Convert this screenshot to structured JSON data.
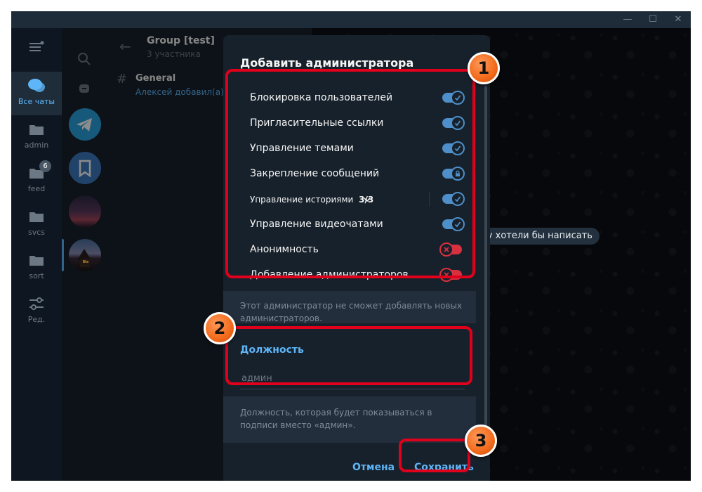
{
  "topic_panel": {
    "back_arrow": "←",
    "group_title": "Group [test]",
    "group_subtitle": "3 участника",
    "topic_hash": "#",
    "topic_name": "General",
    "topic_preview": "Алексей добавил(а) С"
  },
  "folders": [
    {
      "label": "Все чаты",
      "icon": "chats-icon"
    },
    {
      "label": "admin",
      "icon": "folder-icon"
    },
    {
      "label": "feed",
      "icon": "folder-icon",
      "badge": "6"
    },
    {
      "label": "svcs",
      "icon": "folder-icon"
    },
    {
      "label": "sort",
      "icon": "folder-icon"
    },
    {
      "label": "Ред.",
      "icon": "edit-folders-icon"
    }
  ],
  "chat_pill": "му хотели бы написать",
  "dialog": {
    "title": "Добавить администратора",
    "permissions": [
      {
        "label": "Блокировка пользователей",
        "state": "on"
      },
      {
        "label": "Пригласительные ссылки",
        "state": "on"
      },
      {
        "label": "Управление темами",
        "state": "on"
      },
      {
        "label": "Закрепление сообщений",
        "state": "locked"
      },
      {
        "label": "Управление историями",
        "count": "3/3",
        "state": "on"
      },
      {
        "label": "Управление видеочатами",
        "state": "on"
      },
      {
        "label": "Анонимность",
        "state": "off"
      },
      {
        "label": "Добавление администраторов",
        "state": "off"
      }
    ],
    "note_admins": "Этот администратор не сможет добавлять новых администраторов.",
    "position_label": "Должность",
    "position_placeholder": "админ",
    "position_note": "Должность, которая будет показываться в подписи вместо «админ».",
    "cancel_label": "Отмена",
    "save_label": "Сохранить"
  },
  "markers": [
    "1",
    "2",
    "3"
  ],
  "colors": {
    "accent": "#5eb5f7",
    "toggle_on": "#4e8ec9",
    "toggle_off": "#d8303f",
    "highlight": "#e0001b",
    "marker": "#f26a1b"
  }
}
